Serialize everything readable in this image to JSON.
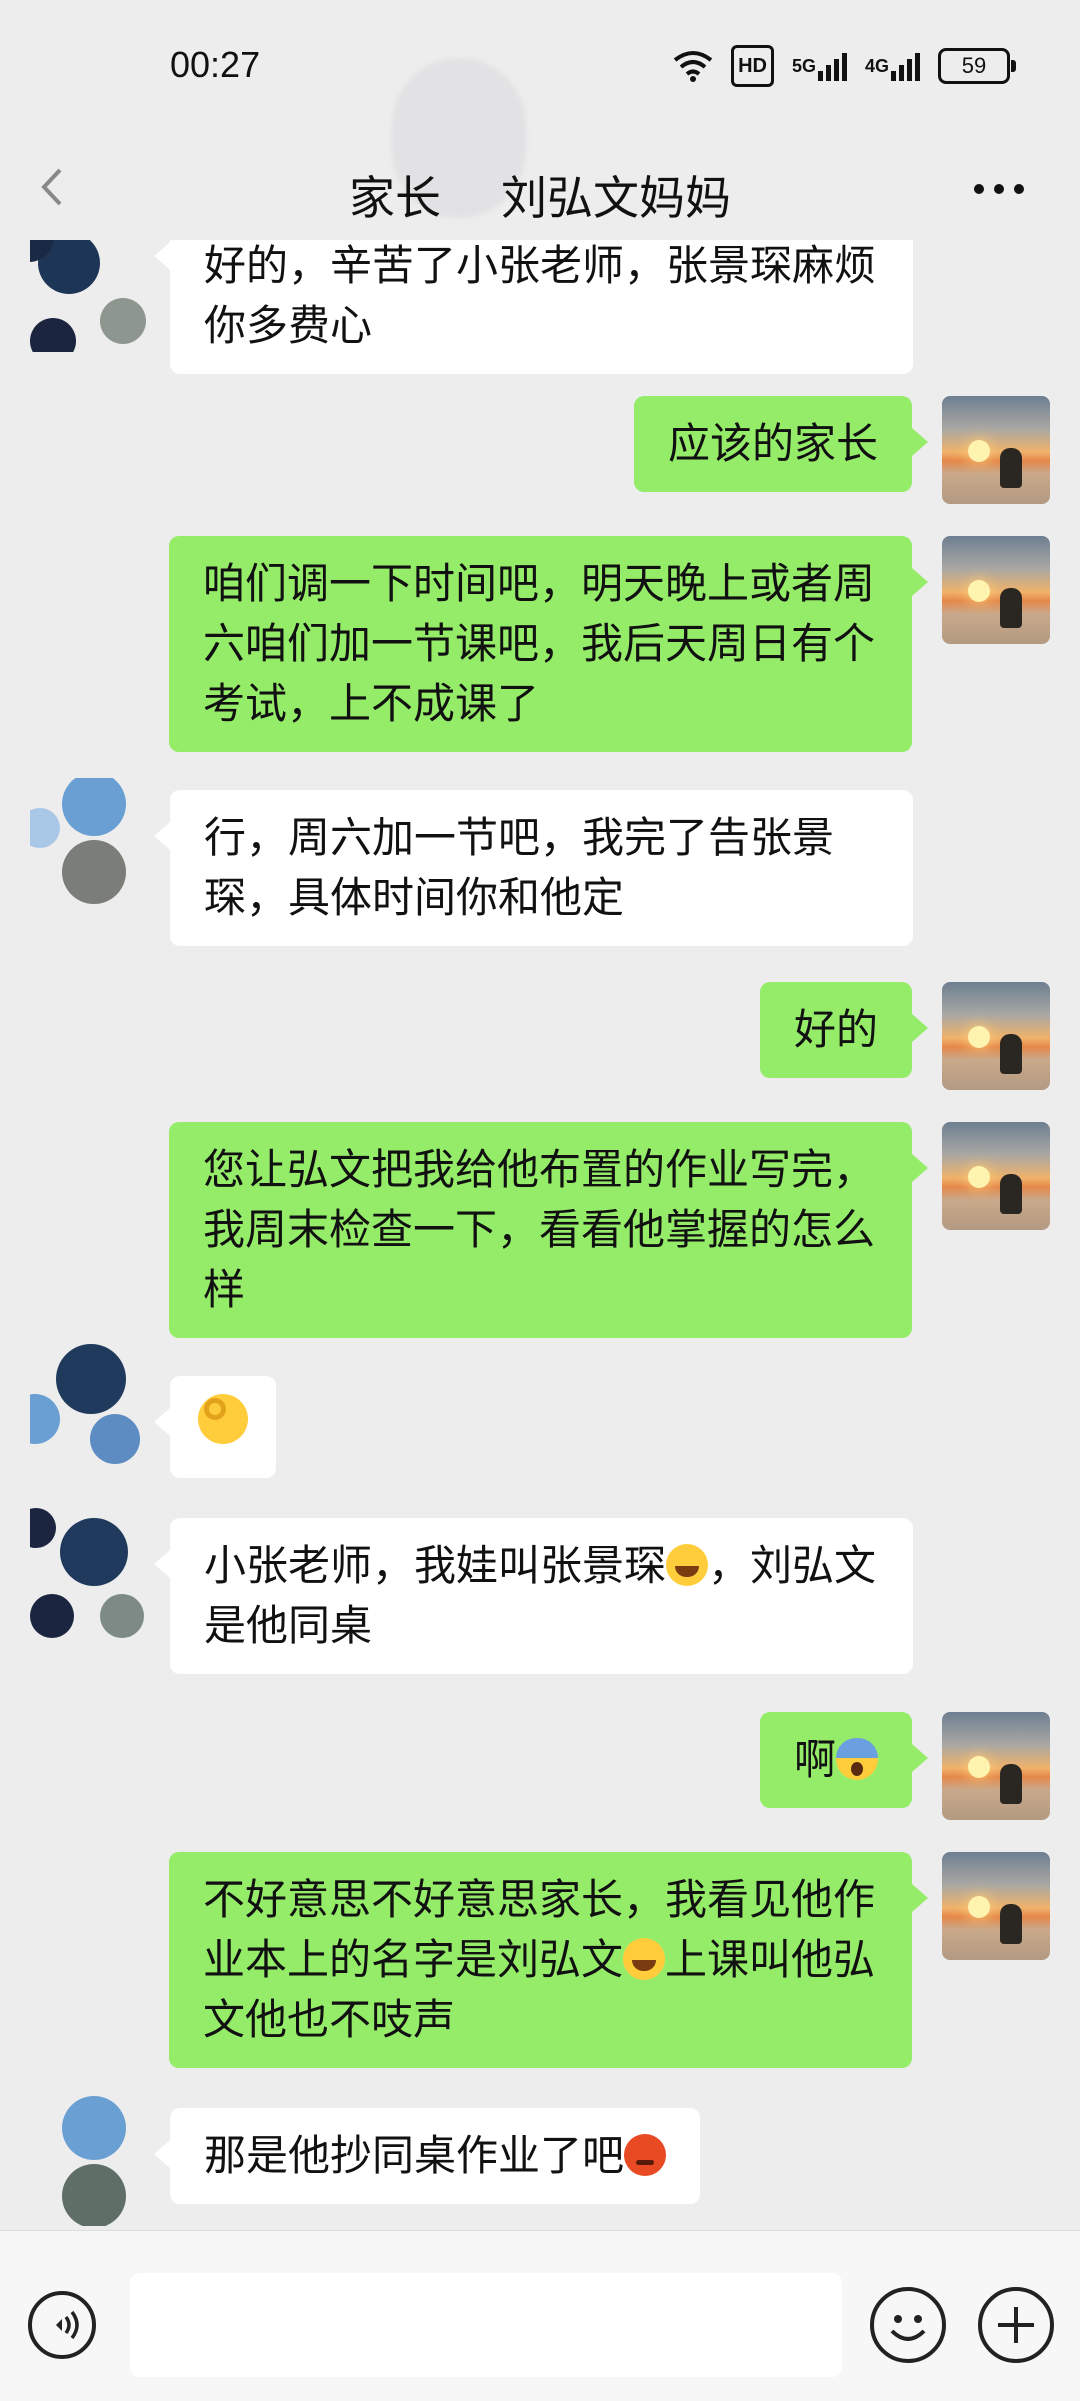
{
  "status_bar": {
    "time": "00:27",
    "hd_label": "HD",
    "net1_label": "5G",
    "net2_label": "4G",
    "battery": "59"
  },
  "header": {
    "title_prefix": "家长",
    "title_suffix": "刘弘文妈妈",
    "back_icon": "chevron-left-icon",
    "more_icon": "more-dots-icon"
  },
  "messages": [
    {
      "side": "in",
      "text": "好的，辛苦了小张老师，张景琛麻烦你多费心"
    },
    {
      "side": "out",
      "text": "应该的家长"
    },
    {
      "side": "out",
      "text": "咱们调一下时间吧，明天晚上或者周六咱们加一节课吧，我后天周日有个考试，上不成课了"
    },
    {
      "side": "in",
      "text": "行，周六加一节吧，我完了告张景琛，具体时间你和他定"
    },
    {
      "side": "out",
      "text": "好的"
    },
    {
      "side": "out",
      "text": "您让弘文把我给他布置的作业写完，我周末检查一下，看看他掌握的怎么样"
    },
    {
      "side": "in",
      "emoji": "ok-hand-icon"
    },
    {
      "side": "in",
      "text_a": "小张老师，我娃叫张景琛",
      "text_b": "，刘弘文是他同桌",
      "emoji": "laugh-tears-icon"
    },
    {
      "side": "out",
      "text": "啊",
      "emoji": "screaming-face-icon"
    },
    {
      "side": "out",
      "text_a": "不好意思不好意思家长，我看见他作业本上的名字是刘弘文",
      "text_b": "上课叫他弘文他也不吱声",
      "emoji": "laugh-tears-icon"
    },
    {
      "side": "in",
      "text": "那是他抄同桌作业了吧",
      "emoji": "angry-face-icon"
    }
  ],
  "input_bar": {
    "value": "",
    "placeholder": "",
    "voice_icon": "voice-icon",
    "emoji_icon": "emoji-smile-icon",
    "plus_icon": "plus-icon"
  }
}
